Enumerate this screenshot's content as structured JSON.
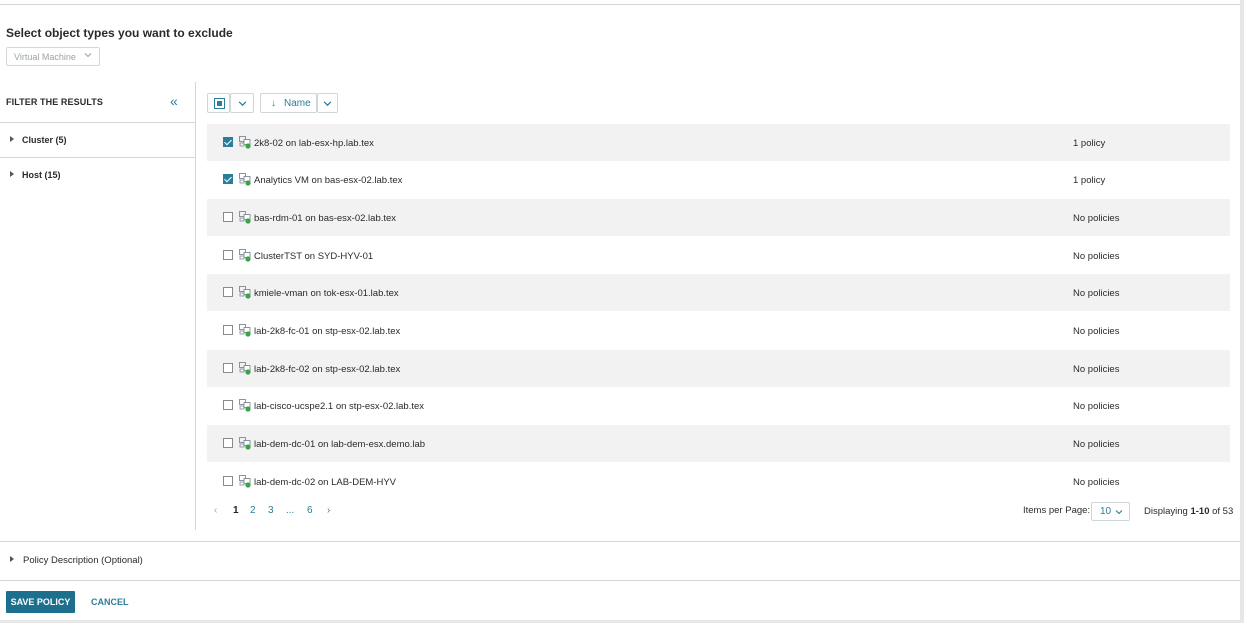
{
  "exclude": {
    "title": "Select object types you want to exclude",
    "type_select_value": "Virtual Machine"
  },
  "filter": {
    "header": "FILTER THE RESULTS",
    "collapse_glyph": "«",
    "items": [
      {
        "label": "Cluster (5)"
      },
      {
        "label": "Host (15)"
      }
    ]
  },
  "toolbar": {
    "sort_arrow": "↓",
    "sort_label": "Name"
  },
  "rows": [
    {
      "name": "2k8-02 on lab-esx-hp.lab.tex",
      "policy": "1 policy",
      "checked": true
    },
    {
      "name": "Analytics VM on bas-esx-02.lab.tex",
      "policy": "1 policy",
      "checked": true
    },
    {
      "name": "bas-rdm-01 on bas-esx-02.lab.tex",
      "policy": "No policies",
      "checked": false
    },
    {
      "name": "ClusterTST on SYD-HYV-01",
      "policy": "No policies",
      "checked": false
    },
    {
      "name": "kmiele-vman on tok-esx-01.lab.tex",
      "policy": "No policies",
      "checked": false
    },
    {
      "name": "lab-2k8-fc-01 on stp-esx-02.lab.tex",
      "policy": "No policies",
      "checked": false
    },
    {
      "name": "lab-2k8-fc-02 on stp-esx-02.lab.tex",
      "policy": "No policies",
      "checked": false
    },
    {
      "name": "lab-cisco-ucspe2.1 on stp-esx-02.lab.tex",
      "policy": "No policies",
      "checked": false
    },
    {
      "name": "lab-dem-dc-01 on lab-dem-esx.demo.lab",
      "policy": "No policies",
      "checked": false
    },
    {
      "name": "lab-dem-dc-02 on LAB-DEM-HYV",
      "policy": "No policies",
      "checked": false
    }
  ],
  "pagination": {
    "prev": "‹",
    "pages": [
      "1",
      "2",
      "3",
      "...",
      "6"
    ],
    "next": "›",
    "current": "1",
    "items_per_page_label": "Items per Page:",
    "items_per_page_value": "10",
    "displaying_prefix": "Displaying ",
    "displaying_range": "1-10",
    "displaying_suffix": " of 53"
  },
  "policy_description": {
    "label": "Policy Description (Optional)"
  },
  "actions": {
    "save_label": "SAVE POLICY",
    "cancel_label": "CANCEL"
  },
  "colors": {
    "accent": "#2b7d9a",
    "primary_button": "#1d6f8e",
    "row_stripe": "#f2f2f2"
  },
  "icons": {
    "vm": "virtual-machine-icon",
    "collapse": "double-chevron-left-icon",
    "dropdown": "chevron-down-icon"
  }
}
